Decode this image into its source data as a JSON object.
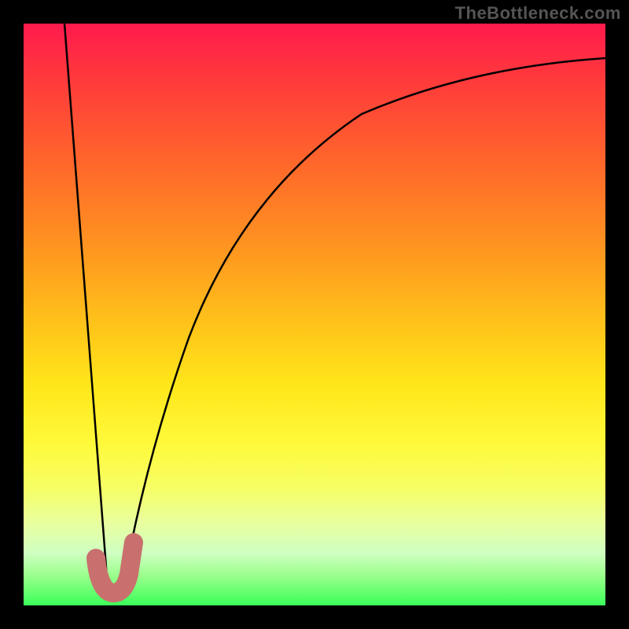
{
  "watermark": "TheBottleneck.com",
  "chart_data": {
    "type": "line",
    "title": "",
    "xlabel": "",
    "ylabel": "",
    "xlim": [
      0,
      100
    ],
    "ylim": [
      0,
      100
    ],
    "grid": false,
    "legend": false,
    "series": [
      {
        "name": "left-branch",
        "x": [
          7,
          14.5
        ],
        "y": [
          100,
          3
        ],
        "color": "#000000",
        "stroke_width": 2
      },
      {
        "name": "right-branch",
        "x": [
          17,
          20,
          24,
          28,
          33,
          40,
          48,
          58,
          70,
          84,
          100
        ],
        "y": [
          3,
          15,
          30,
          43,
          55,
          66,
          75,
          82,
          87,
          91,
          94
        ],
        "color": "#000000",
        "stroke_width": 2
      },
      {
        "name": "optimum-marker",
        "x": [
          12.5,
          13.2,
          14.5,
          16,
          17.5,
          18.5
        ],
        "y": [
          8,
          4,
          2.5,
          3,
          6,
          11
        ],
        "color": "#c9706e",
        "stroke_width": 14
      }
    ],
    "background_gradient": {
      "orientation": "vertical",
      "stops": [
        {
          "pos": 0.0,
          "color": "#ff1a4d"
        },
        {
          "pos": 0.5,
          "color": "#ffd21a"
        },
        {
          "pos": 0.8,
          "color": "#f6ff66"
        },
        {
          "pos": 1.0,
          "color": "#3bff5a"
        }
      ]
    }
  }
}
